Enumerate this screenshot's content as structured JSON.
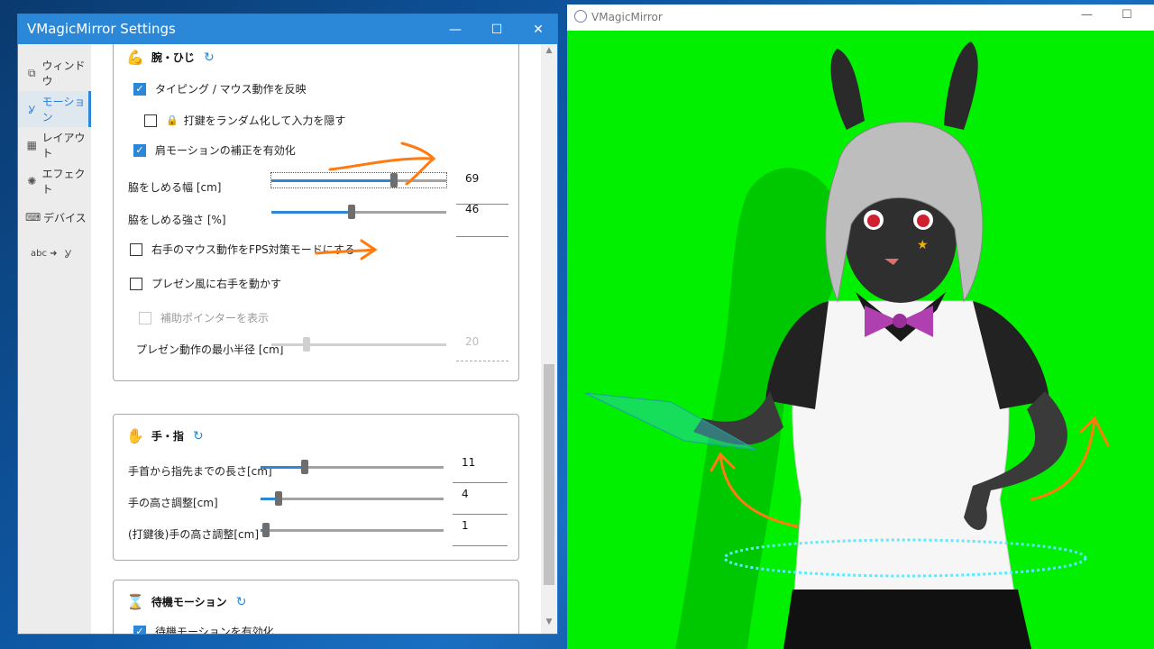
{
  "settings_window": {
    "title": "VMagicMirror Settings",
    "controls": {
      "minimize": "—",
      "maximize": "☐",
      "close": "✕"
    }
  },
  "sidebar": {
    "items": [
      {
        "icon": "window-icon",
        "label": "ウィンドウ",
        "active": false
      },
      {
        "icon": "person-motion-icon",
        "label": "モーション",
        "active": true
      },
      {
        "icon": "layout-icon",
        "label": "レイアウト",
        "active": false
      },
      {
        "icon": "effect-icon",
        "label": "エフェクト",
        "active": false
      },
      {
        "icon": "device-icon",
        "label": "デバイス",
        "active": false
      },
      {
        "icon": "word-to-motion-icon",
        "label": "abc ➜",
        "active": false
      }
    ]
  },
  "arm_section": {
    "title": "腕・ひじ",
    "typing_mouse": {
      "label": "タイピング / マウス動作を反映",
      "checked": true
    },
    "randomize_keys": {
      "label": "打鍵をランダム化して入力を隠す",
      "checked": false
    },
    "shoulder_correction": {
      "label": "肩モーションの補正を有効化",
      "checked": true
    },
    "waist_width": {
      "label": "脇をしめる幅 [cm]",
      "value": "69",
      "fraction": 0.7
    },
    "waist_strength": {
      "label": "脇をしめる強さ [%]",
      "value": "46",
      "fraction": 0.46
    },
    "fps_mode": {
      "label": "右手のマウス動作をFPS対策モードにする",
      "checked": false
    },
    "presentation": {
      "label": "プレゼン風に右手を動かす",
      "checked": false
    },
    "show_pointer": {
      "label": "補助ポインターを表示",
      "checked": false
    },
    "presentation_radius": {
      "label": "プレゼン動作の最小半径 [cm]",
      "value": "20",
      "fraction": 0.2
    }
  },
  "hand_section": {
    "title": "手・指",
    "wrist_to_tip": {
      "label": "手首から指先までの長さ[cm]",
      "value": "11",
      "fraction": 0.24
    },
    "hand_height": {
      "label": "手の高さ調整[cm]",
      "value": "4",
      "fraction": 0.1
    },
    "hand_height_after": {
      "label": "(打鍵後)手の高さ調整[cm]",
      "value": "1",
      "fraction": 0.03
    }
  },
  "idle_section": {
    "title": "待機モーション",
    "enable_idle": {
      "label": "待機モーションを有効化",
      "checked": true
    }
  },
  "mirror_window": {
    "title": "VMagicMirror",
    "background_color": "#00f000"
  },
  "colors": {
    "accent": "#2b88d8",
    "annotation": "#ff7a10"
  }
}
